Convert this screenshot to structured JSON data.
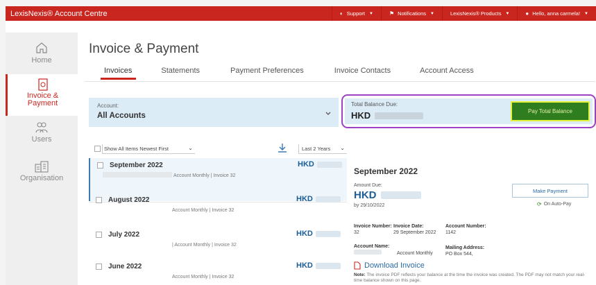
{
  "topbar": {
    "brand": "LexisNexis® Account Centre",
    "items": [
      {
        "icon": "support-icon",
        "label": "Support"
      },
      {
        "icon": "flag-icon",
        "label": "Notifications"
      },
      {
        "icon": "",
        "label": "LexisNexis® Products"
      },
      {
        "icon": "user-icon",
        "label": "Hello, anna carmela!"
      }
    ]
  },
  "sidebar": {
    "items": [
      {
        "label": "Home",
        "icon": "home-icon"
      },
      {
        "label": "Invoice &",
        "label2": "Payment",
        "icon": "invoice-icon",
        "active": true
      },
      {
        "label": "Users",
        "icon": "users-icon"
      },
      {
        "label": "Organisation",
        "icon": "building-icon"
      }
    ]
  },
  "page": {
    "title": "Invoice & Payment",
    "tabs": [
      "Invoices",
      "Statements",
      "Payment Preferences",
      "Invoice Contacts",
      "Account Access"
    ]
  },
  "account": {
    "label": "Account:",
    "value": "All Accounts"
  },
  "balance": {
    "label": "Total Balance Due:",
    "currency": "HKD",
    "pay_label": "Pay Total Balance"
  },
  "list": {
    "filter": "Show All Items  Newest First",
    "range": "Last 2 Years",
    "invoices": [
      {
        "month": "September 2022",
        "sub": "Account Monthly | Invoice 32",
        "currency": "HKD"
      },
      {
        "month": "August 2022",
        "sub": "Account Monthly | Invoice 32",
        "currency": "HKD"
      },
      {
        "month": "July 2022",
        "sub": "| Account Monthly | Invoice 32",
        "currency": "HKD"
      },
      {
        "month": "June 2022",
        "sub": "Account Monthly | Invoice 32",
        "currency": "HKD"
      }
    ]
  },
  "detail": {
    "title": "September 2022",
    "amount_label": "Amount Due:",
    "currency": "HKD",
    "due": "by 29/10/2022",
    "make_payment": "Make Payment",
    "autopay": "On Auto-Pay",
    "invoice_number_label": "Invoice Number:",
    "invoice_number": "32",
    "invoice_date_label": "Invoice Date:",
    "invoice_date": "29 September 2022",
    "account_number_label": "Account Number:",
    "account_number": "1142",
    "account_name_label": "Account Name:",
    "account_name": "Account Monthly",
    "mailing_label": "Mailing Address:",
    "mailing": "PO Box 544,",
    "download": "Download Invoice",
    "note_label": "Note:",
    "note": "The invoice PDF reflects your balance at the time the invoice was created. The PDF may not match your real-time balance shown on this page."
  },
  "colors": {
    "brand_red": "#c9261f",
    "link_blue": "#1c5d94",
    "pay_green": "#2e7d1e",
    "highlight_purple": "#9b41c2"
  }
}
